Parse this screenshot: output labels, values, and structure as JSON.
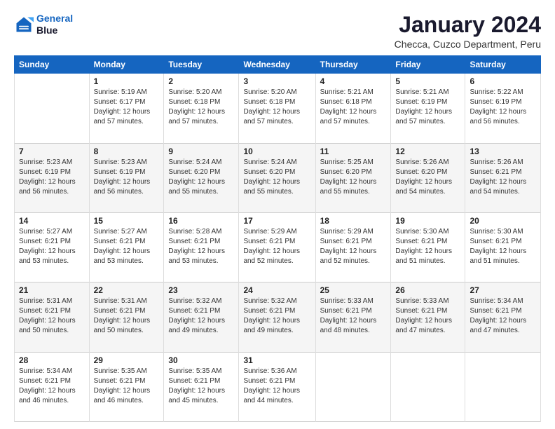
{
  "logo": {
    "line1": "General",
    "line2": "Blue"
  },
  "title": "January 2024",
  "subtitle": "Checca, Cuzco Department, Peru",
  "header_days": [
    "Sunday",
    "Monday",
    "Tuesday",
    "Wednesday",
    "Thursday",
    "Friday",
    "Saturday"
  ],
  "weeks": [
    [
      {
        "day": "",
        "info": ""
      },
      {
        "day": "1",
        "info": "Sunrise: 5:19 AM\nSunset: 6:17 PM\nDaylight: 12 hours\nand 57 minutes."
      },
      {
        "day": "2",
        "info": "Sunrise: 5:20 AM\nSunset: 6:18 PM\nDaylight: 12 hours\nand 57 minutes."
      },
      {
        "day": "3",
        "info": "Sunrise: 5:20 AM\nSunset: 6:18 PM\nDaylight: 12 hours\nand 57 minutes."
      },
      {
        "day": "4",
        "info": "Sunrise: 5:21 AM\nSunset: 6:18 PM\nDaylight: 12 hours\nand 57 minutes."
      },
      {
        "day": "5",
        "info": "Sunrise: 5:21 AM\nSunset: 6:19 PM\nDaylight: 12 hours\nand 57 minutes."
      },
      {
        "day": "6",
        "info": "Sunrise: 5:22 AM\nSunset: 6:19 PM\nDaylight: 12 hours\nand 56 minutes."
      }
    ],
    [
      {
        "day": "7",
        "info": "Sunrise: 5:23 AM\nSunset: 6:19 PM\nDaylight: 12 hours\nand 56 minutes."
      },
      {
        "day": "8",
        "info": "Sunrise: 5:23 AM\nSunset: 6:19 PM\nDaylight: 12 hours\nand 56 minutes."
      },
      {
        "day": "9",
        "info": "Sunrise: 5:24 AM\nSunset: 6:20 PM\nDaylight: 12 hours\nand 55 minutes."
      },
      {
        "day": "10",
        "info": "Sunrise: 5:24 AM\nSunset: 6:20 PM\nDaylight: 12 hours\nand 55 minutes."
      },
      {
        "day": "11",
        "info": "Sunrise: 5:25 AM\nSunset: 6:20 PM\nDaylight: 12 hours\nand 55 minutes."
      },
      {
        "day": "12",
        "info": "Sunrise: 5:26 AM\nSunset: 6:20 PM\nDaylight: 12 hours\nand 54 minutes."
      },
      {
        "day": "13",
        "info": "Sunrise: 5:26 AM\nSunset: 6:21 PM\nDaylight: 12 hours\nand 54 minutes."
      }
    ],
    [
      {
        "day": "14",
        "info": "Sunrise: 5:27 AM\nSunset: 6:21 PM\nDaylight: 12 hours\nand 53 minutes."
      },
      {
        "day": "15",
        "info": "Sunrise: 5:27 AM\nSunset: 6:21 PM\nDaylight: 12 hours\nand 53 minutes."
      },
      {
        "day": "16",
        "info": "Sunrise: 5:28 AM\nSunset: 6:21 PM\nDaylight: 12 hours\nand 53 minutes."
      },
      {
        "day": "17",
        "info": "Sunrise: 5:29 AM\nSunset: 6:21 PM\nDaylight: 12 hours\nand 52 minutes."
      },
      {
        "day": "18",
        "info": "Sunrise: 5:29 AM\nSunset: 6:21 PM\nDaylight: 12 hours\nand 52 minutes."
      },
      {
        "day": "19",
        "info": "Sunrise: 5:30 AM\nSunset: 6:21 PM\nDaylight: 12 hours\nand 51 minutes."
      },
      {
        "day": "20",
        "info": "Sunrise: 5:30 AM\nSunset: 6:21 PM\nDaylight: 12 hours\nand 51 minutes."
      }
    ],
    [
      {
        "day": "21",
        "info": "Sunrise: 5:31 AM\nSunset: 6:21 PM\nDaylight: 12 hours\nand 50 minutes."
      },
      {
        "day": "22",
        "info": "Sunrise: 5:31 AM\nSunset: 6:21 PM\nDaylight: 12 hours\nand 50 minutes."
      },
      {
        "day": "23",
        "info": "Sunrise: 5:32 AM\nSunset: 6:21 PM\nDaylight: 12 hours\nand 49 minutes."
      },
      {
        "day": "24",
        "info": "Sunrise: 5:32 AM\nSunset: 6:21 PM\nDaylight: 12 hours\nand 49 minutes."
      },
      {
        "day": "25",
        "info": "Sunrise: 5:33 AM\nSunset: 6:21 PM\nDaylight: 12 hours\nand 48 minutes."
      },
      {
        "day": "26",
        "info": "Sunrise: 5:33 AM\nSunset: 6:21 PM\nDaylight: 12 hours\nand 47 minutes."
      },
      {
        "day": "27",
        "info": "Sunrise: 5:34 AM\nSunset: 6:21 PM\nDaylight: 12 hours\nand 47 minutes."
      }
    ],
    [
      {
        "day": "28",
        "info": "Sunrise: 5:34 AM\nSunset: 6:21 PM\nDaylight: 12 hours\nand 46 minutes."
      },
      {
        "day": "29",
        "info": "Sunrise: 5:35 AM\nSunset: 6:21 PM\nDaylight: 12 hours\nand 46 minutes."
      },
      {
        "day": "30",
        "info": "Sunrise: 5:35 AM\nSunset: 6:21 PM\nDaylight: 12 hours\nand 45 minutes."
      },
      {
        "day": "31",
        "info": "Sunrise: 5:36 AM\nSunset: 6:21 PM\nDaylight: 12 hours\nand 44 minutes."
      },
      {
        "day": "",
        "info": ""
      },
      {
        "day": "",
        "info": ""
      },
      {
        "day": "",
        "info": ""
      }
    ]
  ]
}
